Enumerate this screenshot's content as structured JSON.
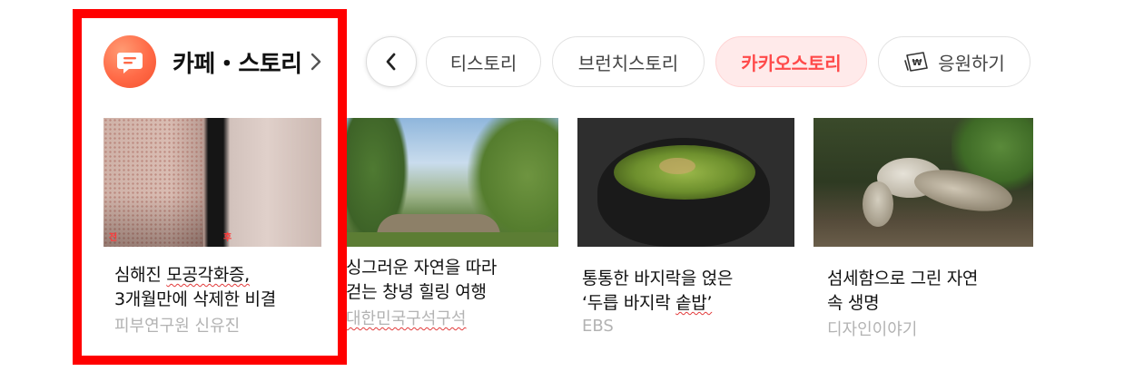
{
  "header": {
    "brand_icon": "chat-bubble-icon",
    "brand_color": "#ff6a47",
    "title": "카페・스토리",
    "chevron_icon": "chevron-right-icon"
  },
  "nav": {
    "prev_icon": "chevron-left-icon",
    "accent_color": "#ff4a4a",
    "tabs": [
      {
        "label": "티스토리",
        "active": false
      },
      {
        "label": "브런치스토리",
        "active": false
      },
      {
        "label": "카카오스토리",
        "active": true
      },
      {
        "label": "응원하기",
        "active": false,
        "icon": "cheer-won-icon"
      }
    ]
  },
  "cards": [
    {
      "title_lines": [
        "심해진 모공각화증,",
        "3개월만에 삭제한 비결"
      ],
      "source": "피부연구원 신유진",
      "image": "skin-before-after-photo",
      "image_labels": [
        "전",
        "후"
      ]
    },
    {
      "title_lines": [
        "싱그러운 자연을 따라",
        "걷는 창녕 힐링 여행"
      ],
      "source": "대한민국구석구석",
      "image": "stone-bridge-landscape-photo"
    },
    {
      "title_lines": [
        "통통한 바지락을 얹은",
        "‘두릅 바지락 솥밥’"
      ],
      "source": "EBS",
      "image": "clam-rice-pot-photo"
    },
    {
      "title_lines": [
        "섬세함으로 그린 자연",
        "속 생명"
      ],
      "source": "디자인이야기",
      "image": "bird-painting-photo"
    }
  ]
}
